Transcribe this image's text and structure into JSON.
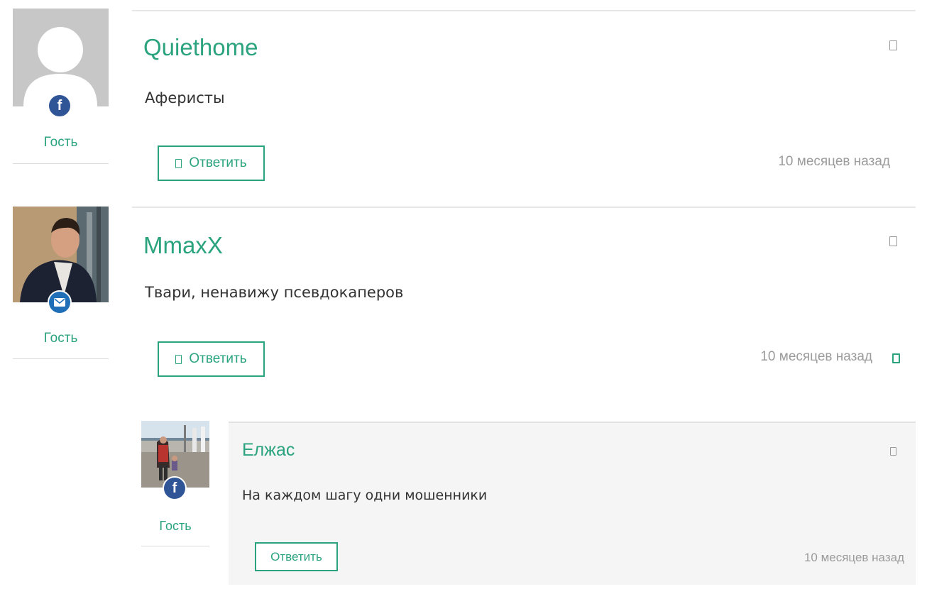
{
  "comments": [
    {
      "author": "Quiethome",
      "text": "Аферисты",
      "role": "Гость",
      "reply_label": "Ответить",
      "time": "10 месяцев назад",
      "social": "f"
    },
    {
      "author": "MmaxX",
      "text": "Твари, ненавижу псевдокаперов",
      "role": "Гость",
      "reply_label": "Ответить",
      "time": "10 месяцев назад",
      "social": "mail-icon"
    },
    {
      "author": "Елжас",
      "text": "На каждом шагу одни мошенники",
      "role": "Гость",
      "reply_label": "Ответить",
      "time": "10 месяцев назад",
      "social": "f"
    }
  ],
  "colors": {
    "accent": "#2aa37e",
    "facebook": "#2f5597",
    "mail": "#1e6fb8",
    "meta_text": "#9b9b9b"
  }
}
